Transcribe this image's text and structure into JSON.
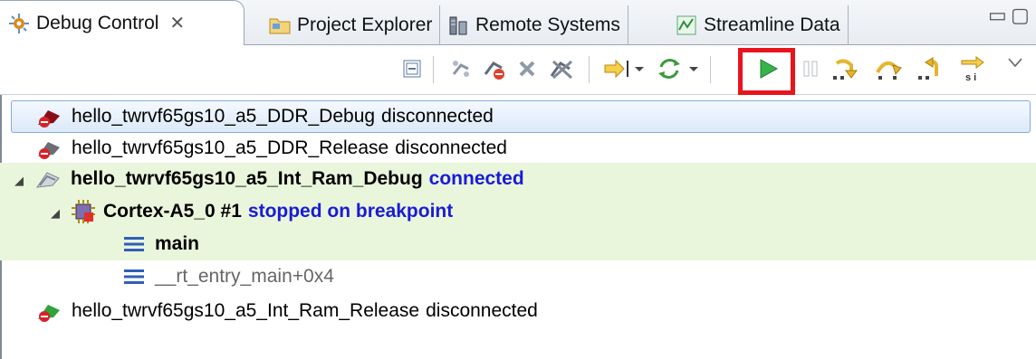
{
  "tabs": [
    {
      "label": "Debug Control",
      "active": true,
      "icon": "debug-control-icon",
      "close_glyph": "✕"
    },
    {
      "label": "Project Explorer",
      "active": false,
      "icon": "project-folder-icon"
    },
    {
      "label": "Remote Systems",
      "active": false,
      "icon": "remote-systems-icon"
    },
    {
      "label": "Streamline Data",
      "active": false,
      "icon": "streamline-data-icon"
    }
  ],
  "window_controls": {
    "minimize": "▭",
    "maximize": "▢"
  },
  "toolbar": {
    "buttons": [
      "collapse-all-icon",
      "connect-icon",
      "disconnect-icon",
      "delete-connection-icon",
      "disconnect-all-icon",
      "step-into-source-icon",
      "refresh-icon",
      "continue-icon",
      "pause-icon",
      "step-into-icon",
      "step-over-icon",
      "step-out-icon",
      "step-instruction-icon",
      "view-menu-icon"
    ],
    "highlighted_button": "continue-icon",
    "highlight_color": "#e8141c"
  },
  "tree": {
    "rows": [
      {
        "name": "hello_twrvf65gs10_a5_DDR_Debug",
        "status": "disconnected",
        "selected": true
      },
      {
        "name": "hello_twrvf65gs10_a5_DDR_Release",
        "status": "disconnected"
      },
      {
        "name": "hello_twrvf65gs10_a5_Int_Ram_Debug",
        "status": "connected",
        "expanded": true
      },
      {
        "name": "Cortex-A5_0 #1",
        "status": "stopped on breakpoint",
        "expanded": true
      },
      {
        "name": "main"
      },
      {
        "name": "__rt_entry_main+0x4"
      },
      {
        "name": "hello_twrvf65gs10_a5_Int_Ram_Release",
        "status": "disconnected"
      }
    ]
  },
  "colors": {
    "connected_status": "#1a1ad6",
    "active_row_bg": "#e9f6dc",
    "selected_row_border": "#84acdd"
  }
}
